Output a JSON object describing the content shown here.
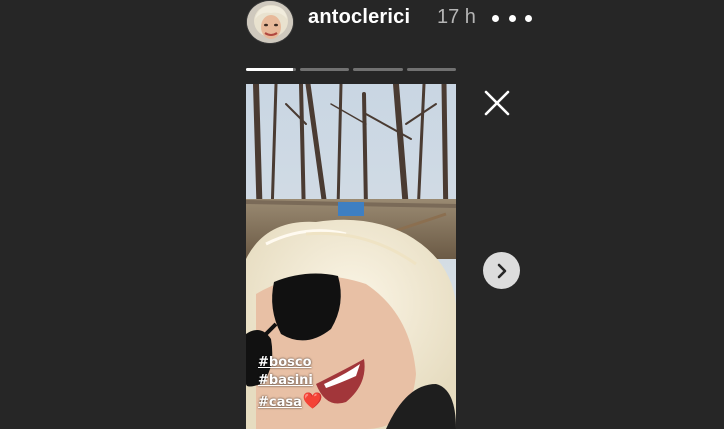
{
  "header": {
    "username": "antoclerici",
    "timestamp": "17 h",
    "avatar_icon": "profile-photo",
    "more_icon": "more-dots-icon"
  },
  "progress": {
    "segments": 4,
    "current_index": 0,
    "current_fraction": 0.95
  },
  "story": {
    "hashtags": [
      "#bosco",
      "#basini",
      "#casa"
    ],
    "casa_emoji": "❤️"
  },
  "controls": {
    "close_icon": "close-icon",
    "next_icon": "chevron-right-icon"
  },
  "colors": {
    "background": "#262626",
    "text": "#ffffff",
    "timestamp": "#b5b5b5",
    "heart": "#e0252d"
  }
}
